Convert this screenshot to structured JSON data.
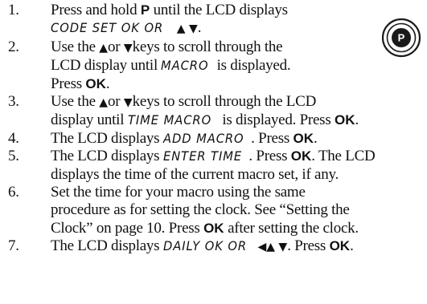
{
  "steps": [
    {
      "number": "1.",
      "lines": [
        [
          {
            "t": "text",
            "v": "Press and hold "
          },
          {
            "t": "key",
            "v": "P"
          },
          {
            "t": "text",
            "v": " until the LCD displays"
          }
        ],
        [
          {
            "t": "lcd",
            "v": "CODE SET OK OR"
          },
          {
            "t": "text",
            "v": " "
          },
          {
            "t": "glyph",
            "v": "▲ ▼"
          },
          {
            "t": "text",
            "v": "."
          }
        ]
      ]
    },
    {
      "number": "2.",
      "lines": [
        [
          {
            "t": "text",
            "v": "Use the  "
          },
          {
            "t": "glyph",
            "v": "▲"
          },
          {
            "t": "text",
            "v": "or "
          },
          {
            "t": "glyph",
            "v": "▼"
          },
          {
            "t": "text",
            "v": "keys to scroll through the"
          }
        ],
        [
          {
            "t": "text",
            "v": "LCD display until "
          },
          {
            "t": "lcd",
            "v": "MACRO"
          },
          {
            "t": "text",
            "v": " is displayed."
          }
        ],
        [
          {
            "t": "text",
            "v": "Press "
          },
          {
            "t": "key",
            "v": "OK"
          },
          {
            "t": "text",
            "v": "."
          }
        ]
      ]
    },
    {
      "number": "3.",
      "lines": [
        [
          {
            "t": "text",
            "v": "Use the  "
          },
          {
            "t": "glyph",
            "v": "▲"
          },
          {
            "t": "text",
            "v": "or "
          },
          {
            "t": "glyph",
            "v": "▼"
          },
          {
            "t": "text",
            "v": "keys to scroll through the LCD"
          }
        ],
        [
          {
            "t": "text",
            "v": "display until "
          },
          {
            "t": "lcd",
            "v": "TIME MACRO"
          },
          {
            "t": "text",
            "v": " is displayed. Press "
          },
          {
            "t": "key",
            "v": "OK"
          },
          {
            "t": "text",
            "v": "."
          }
        ]
      ]
    },
    {
      "number": "4.",
      "lines": [
        [
          {
            "t": "text",
            "v": "The LCD displays "
          },
          {
            "t": "lcd",
            "v": "ADD MACRO"
          },
          {
            "t": "text",
            "v": ". Press "
          },
          {
            "t": "key",
            "v": "OK"
          },
          {
            "t": "text",
            "v": "."
          }
        ]
      ]
    },
    {
      "number": "5.",
      "lines": [
        [
          {
            "t": "text",
            "v": "The LCD displays "
          },
          {
            "t": "lcd",
            "v": "ENTER TIME"
          },
          {
            "t": "text",
            "v": ". Press "
          },
          {
            "t": "key",
            "v": "OK"
          },
          {
            "t": "text",
            "v": ". The LCD"
          }
        ],
        [
          {
            "t": "text",
            "v": "displays the time of the current macro set, if any."
          }
        ]
      ]
    },
    {
      "number": "6.",
      "lines": [
        [
          {
            "t": "text",
            "v": "Set the time for your macro using the same"
          }
        ],
        [
          {
            "t": "text",
            "v": "procedure as for setting the clock. See “Setting the"
          }
        ],
        [
          {
            "t": "text",
            "v": "Clock” on page 10. Press "
          },
          {
            "t": "key",
            "v": "OK"
          },
          {
            "t": "text",
            "v": " after setting the clock."
          }
        ]
      ]
    },
    {
      "number": "7.",
      "lines": [
        [
          {
            "t": "text",
            "v": "The LCD displays "
          },
          {
            "t": "lcd",
            "v": "DAILY OK OR"
          },
          {
            "t": "text",
            "v": " "
          },
          {
            "t": "glyph",
            "v": "◀▲ ▼"
          },
          {
            "t": "text",
            "v": ". Press "
          },
          {
            "t": "key",
            "v": "OK"
          },
          {
            "t": "text",
            "v": "."
          }
        ]
      ]
    }
  ],
  "p_button": {
    "label": "P",
    "icon": "p-button-icon",
    "colors": {
      "ring": "#1a1a1a",
      "fill": "#ffffff",
      "text": "#ffffff"
    }
  }
}
